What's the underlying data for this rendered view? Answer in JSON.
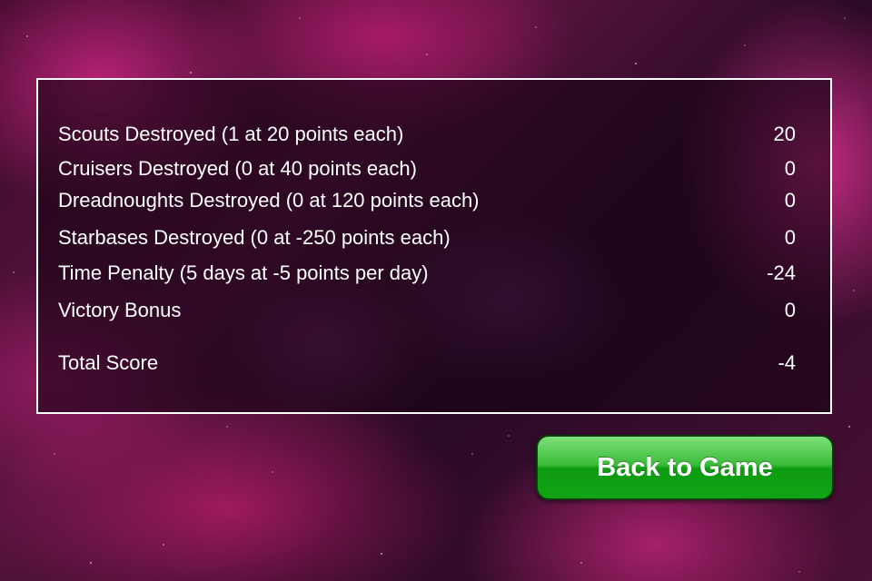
{
  "score_rows": [
    {
      "label": "Scouts Destroyed (1 at 20 points each)",
      "value": "20"
    },
    {
      "label": "Cruisers Destroyed (0 at 40 points each)",
      "value": "0"
    },
    {
      "label": "Dreadnoughts Destroyed (0 at 120 points each)",
      "value": "0"
    },
    {
      "label": "Starbases Destroyed (0 at -250 points each)",
      "value": "0"
    },
    {
      "label": "Time Penalty (5 days at -5 points per day)",
      "value": "-24"
    },
    {
      "label": "Victory Bonus",
      "value": "0"
    }
  ],
  "total": {
    "label": "Total Score",
    "value": "-4"
  },
  "back_button": {
    "label": "Back to Game"
  },
  "colors": {
    "text": "#ffffff",
    "panel_border": "#ffffff",
    "button_green": "#10a414"
  }
}
